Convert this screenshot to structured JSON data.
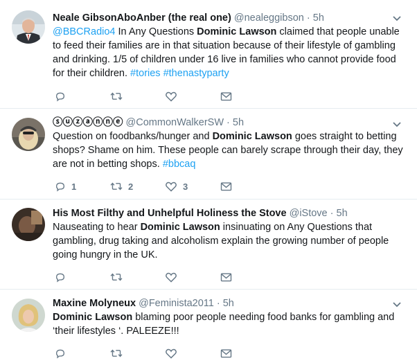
{
  "tweets": [
    {
      "name": "Neale GibsonAboAnber (the real one)",
      "handle": "@nealeggibson",
      "time": "5h",
      "body": [
        {
          "t": "@BBCRadio4",
          "k": "link"
        },
        {
          "t": " In Any Questions ",
          "k": "plain"
        },
        {
          "t": "Dominic Lawson",
          "k": "hl"
        },
        {
          "t": " claimed that people unable to feed their families are in that situation because of their lifestyle of gambling and drinking. 1/5 of children under 16 live in families who cannot provide food for their children. ",
          "k": "plain"
        },
        {
          "t": "#tories",
          "k": "link"
        },
        {
          "t": " ",
          "k": "plain"
        },
        {
          "t": "#thenastyparty",
          "k": "link"
        }
      ],
      "counts": {
        "reply": "",
        "retweet": "",
        "like": ""
      }
    },
    {
      "name": "ⓢⓤⓩⓐⓝⓝⓔ",
      "handle": "@CommonWalkerSW",
      "time": "5h",
      "body": [
        {
          "t": "Question on foodbanks/hunger and ",
          "k": "plain"
        },
        {
          "t": "Dominic Lawson",
          "k": "hl"
        },
        {
          "t": " goes straight to betting shops? Shame on him. These people can barely scrape through their day, they are not in betting shops. ",
          "k": "plain"
        },
        {
          "t": "#bbcaq",
          "k": "link"
        }
      ],
      "counts": {
        "reply": "1",
        "retweet": "2",
        "like": "3"
      }
    },
    {
      "name": "His Most Filthy and Unhelpful Holiness the Stove",
      "handle": "@iStove",
      "time": "5h",
      "body": [
        {
          "t": "Nauseating to hear ",
          "k": "plain"
        },
        {
          "t": "Dominic Lawson",
          "k": "hl"
        },
        {
          "t": " insinuating on Any Questions that gambling, drug taking and alcoholism explain the growing number of people going hungry in the UK.",
          "k": "plain"
        }
      ],
      "counts": {
        "reply": "",
        "retweet": "",
        "like": ""
      }
    },
    {
      "name": "Maxine Molyneux",
      "handle": "@Feminista2011",
      "time": "5h",
      "body": [
        {
          "t": "Dominic Lawson",
          "k": "hl"
        },
        {
          "t": " blaming poor people  needing food banks for gambling and ‘their lifestyles ‘. PALEEZE!!!",
          "k": "plain"
        }
      ],
      "counts": {
        "reply": "",
        "retweet": "",
        "like": ""
      }
    }
  ],
  "separator": " · ",
  "colors": {
    "link": "#1da1f2",
    "muted": "#657786",
    "text": "#14171a",
    "border": "#e6ecf0"
  }
}
